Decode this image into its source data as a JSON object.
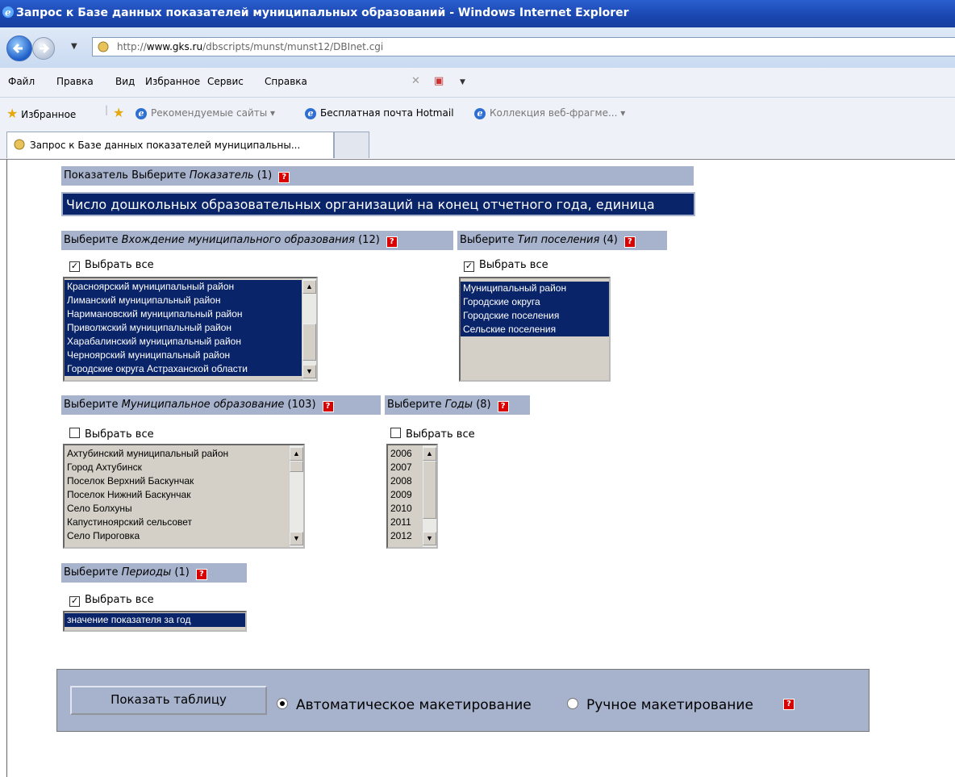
{
  "window": {
    "title": "Запрос к Базе данных показателей муниципальных образований - Windows Internet Explorer"
  },
  "address": {
    "url_prefix": "http://",
    "url_domain": "www.gks.ru",
    "url_path": "/dbscripts/munst/munst12/DBInet.cgi"
  },
  "menu": [
    "Файл",
    "Правка",
    "Вид",
    "Избранное",
    "Сервис",
    "Справка"
  ],
  "favorites": {
    "label": "Избранное",
    "items": [
      "Рекомендуемые сайты ▾",
      "Бесплатная почта Hotmail",
      "Коллекция веб-фрагме... ▾"
    ]
  },
  "tab": {
    "title": "Запрос к Базе данных показателей муниципальны..."
  },
  "indicator": {
    "header_prefix": "Показатель Выберите ",
    "header_italic": "Показатель",
    "header_count": " (1)",
    "selected": "Число дошкольных образовательных организаций на конец отчетного года, единица"
  },
  "municipality_group": {
    "header_prefix": "Выберите ",
    "header_italic": "Вхождение муниципального образования",
    "header_count": " (12)",
    "select_all": "Выбрать все",
    "options": [
      "Красноярский муниципальный район",
      "Лиманский муниципальный район",
      "Наримановский муниципальный район",
      "Приволжский муниципальный район",
      "Харабалинский муниципальный район",
      "Черноярский муниципальный район",
      "Городские округа Астраханской области"
    ]
  },
  "settlement_type": {
    "header_prefix": "Выберите ",
    "header_italic": "Тип поселения",
    "header_count": " (4)",
    "select_all": "Выбрать все",
    "options": [
      "Муниципальный район",
      "Городские округа",
      "Городские поселения",
      "Сельские поселения"
    ]
  },
  "municipality": {
    "header_prefix": "Выберите ",
    "header_italic": "Муниципальное образование",
    "header_count": " (103)",
    "select_all": "Выбрать все",
    "options": [
      "Ахтубинский муниципальный район",
      "Город Ахтубинск",
      "Поселок Верхний Баскунчак",
      "Поселок Нижний Баскунчак",
      "Село Болхуны",
      "Капустиноярский сельсовет",
      "Село Пироговка"
    ]
  },
  "years": {
    "header_prefix": "Выберите ",
    "header_italic": "Годы",
    "header_count": " (8)",
    "select_all": "Выбрать все",
    "options": [
      "2006",
      "2007",
      "2008",
      "2009",
      "2010",
      "2011",
      "2012"
    ]
  },
  "periods": {
    "header_prefix": "Выберите ",
    "header_italic": "Периоды",
    "header_count": " (1)",
    "select_all": "Выбрать все",
    "options": [
      "значение показателя за год"
    ]
  },
  "footer": {
    "show_button": "Показать таблицу",
    "auto_layout": "Автоматическое макетирование",
    "manual_layout": "Ручное макетирование"
  },
  "help_glyph": "?",
  "check_glyph": "✓"
}
